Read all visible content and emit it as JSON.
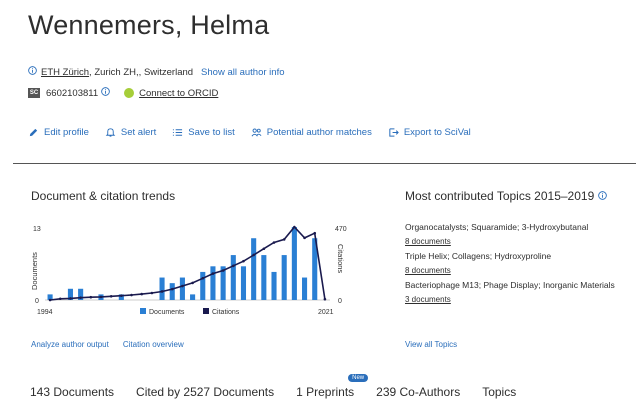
{
  "author": {
    "name": "Wennemers, Helma",
    "affiliation_institution": "ETH Zürich",
    "affiliation_location": ", Zurich ZH,, Switzerland",
    "show_all_info": "Show all author info",
    "author_id": "6602103811",
    "orcid_label": "Connect to ORCID",
    "scopus_badge": "SC"
  },
  "actions": [
    {
      "label": "Edit profile",
      "icon": "pencil-icon"
    },
    {
      "label": "Set alert",
      "icon": "bell-icon"
    },
    {
      "label": "Save to list",
      "icon": "list-icon"
    },
    {
      "label": "Potential author matches",
      "icon": "people-icon"
    },
    {
      "label": "Export to SciVal",
      "icon": "export-icon"
    }
  ],
  "trends": {
    "title": "Document & citation trends",
    "analyze_link": "Analyze author output",
    "citation_overview_link": "Citation overview"
  },
  "chart_data": {
    "type": "bar",
    "x_start_label": "1994",
    "x_end_label": "2021",
    "ylabel_left": "Documents",
    "ylabel_right": "Citations",
    "y_left_ticks": [
      "13",
      "0"
    ],
    "y_right_ticks": [
      "470",
      "0"
    ],
    "ylim_left": [
      0,
      13
    ],
    "ylim_right": [
      0,
      470
    ],
    "years": [
      1994,
      1995,
      1996,
      1997,
      1998,
      1999,
      2000,
      2001,
      2002,
      2003,
      2004,
      2005,
      2006,
      2007,
      2008,
      2009,
      2010,
      2011,
      2012,
      2013,
      2014,
      2015,
      2016,
      2017,
      2018,
      2019,
      2020,
      2021
    ],
    "series": [
      {
        "name": "Documents",
        "color": "#2a7fd4",
        "values": [
          1,
          0,
          2,
          2,
          0,
          1,
          0,
          1,
          0,
          0,
          0,
          4,
          3,
          4,
          1,
          5,
          6,
          6,
          8,
          6,
          11,
          8,
          5,
          8,
          13,
          4,
          11,
          0
        ]
      },
      {
        "name": "Citations",
        "color": "#1a1a4e",
        "values": [
          0,
          8,
          10,
          15,
          18,
          20,
          24,
          28,
          32,
          38,
          45,
          55,
          70,
          90,
          110,
          140,
          170,
          190,
          220,
          250,
          290,
          330,
          370,
          390,
          470,
          400,
          430,
          5
        ]
      }
    ],
    "legend": [
      "Documents",
      "Citations"
    ],
    "legend_position": "bottom"
  },
  "topics": {
    "title": "Most contributed Topics 2015–2019",
    "items": [
      {
        "name": "Organocatalysts; Squaramide; 3-Hydroxybutanal",
        "docs": "8 documents"
      },
      {
        "name": "Triple Helix; Collagens; Hydroxyproline",
        "docs": "8 documents"
      },
      {
        "name": "Bacteriophage M13; Phage Display; Inorganic Materials",
        "docs": "3 documents"
      }
    ],
    "view_all": "View all Topics"
  },
  "tabs": [
    {
      "label": "143 Documents"
    },
    {
      "label": "Cited by 2527 Documents"
    },
    {
      "label": "1 Preprints",
      "badge": "New"
    },
    {
      "label": "239 Co-Authors"
    },
    {
      "label": "Topics"
    }
  ]
}
